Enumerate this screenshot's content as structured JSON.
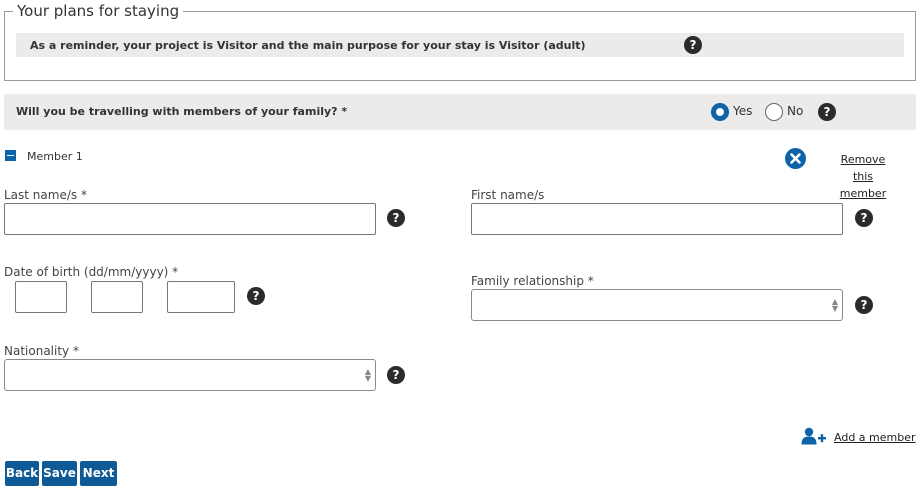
{
  "plans_section": {
    "legend": "Your plans for staying",
    "reminder": "As a reminder, your project is Visitor and the main purpose for your stay is Visitor (adult)"
  },
  "family_question": {
    "label": "Will you be travelling with members of your family? *",
    "options": [
      {
        "label": "Yes",
        "selected": true
      },
      {
        "label": "No",
        "selected": false
      }
    ]
  },
  "member": {
    "title": "Member 1",
    "remove_label": "Remove this member",
    "fields": {
      "last_name": {
        "label": "Last name/s *",
        "value": ""
      },
      "first_name": {
        "label": "First name/s",
        "value": ""
      },
      "date_of_birth": {
        "label": "Date of birth (dd/mm/yyyy) *",
        "day": "",
        "month": "",
        "year": ""
      },
      "family_relationship": {
        "label": "Family relationship *",
        "selected": ""
      },
      "nationality": {
        "label": "Nationality *",
        "selected": ""
      }
    }
  },
  "add_member_label": "Add a member",
  "buttons": {
    "back": "Back",
    "save": "Save",
    "next": "Next"
  },
  "help_icon_glyph": "?",
  "colors": {
    "accent": "#0e63a8",
    "button": "#0e5a96",
    "panel": "#ebebeb",
    "help_icon": "#2b2b2b"
  }
}
